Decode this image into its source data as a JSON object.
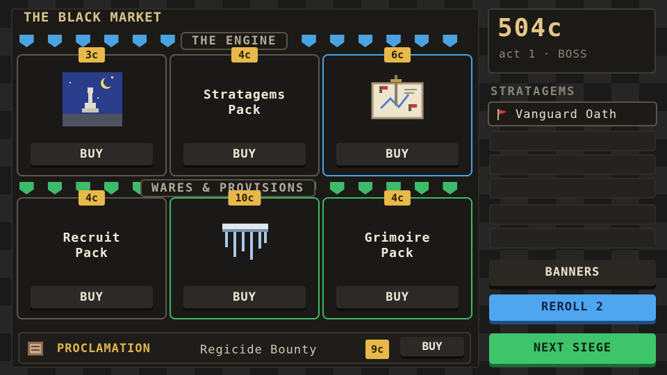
{
  "shop": {
    "title": "THE BLACK MARKET",
    "engine_label": "THE ENGINE",
    "wares_label": "WARES & PROVISIONS",
    "engine_cards": [
      {
        "price": "3c",
        "name": "",
        "icon": "night-moon-pawn-icon",
        "buy": "BUY"
      },
      {
        "price": "4c",
        "name": "Stratagems\nPack",
        "buy": "BUY"
      },
      {
        "price": "6c",
        "name": "",
        "icon": "battle-map-icon",
        "buy": "BUY"
      }
    ],
    "wares_cards": [
      {
        "price": "4c",
        "name": "Recruit\nPack",
        "buy": "BUY"
      },
      {
        "price": "10c",
        "name": "",
        "icon": "icicle-icon",
        "buy": "BUY"
      },
      {
        "price": "4c",
        "name": "Grimoire\nPack",
        "buy": "BUY"
      }
    ],
    "proclamation": {
      "title": "PROCLAMATION",
      "name": "Regicide Bounty",
      "price": "9c",
      "buy": "BUY"
    }
  },
  "status": {
    "money": "504c",
    "act": "act 1 · BOSS"
  },
  "stratagems": {
    "title": "STRATAGEMS",
    "items": [
      "Vanguard Oath"
    ]
  },
  "buttons": {
    "banners": "BANNERS",
    "reroll": "REROLL 2",
    "next": "NEXT SIEGE"
  },
  "colors": {
    "price_tag": "#e8b84a",
    "engine_banner": "#4aa3e0",
    "wares_banner": "#3dbb6a",
    "reroll": "#4fa6f0",
    "next": "#3ec46a"
  }
}
